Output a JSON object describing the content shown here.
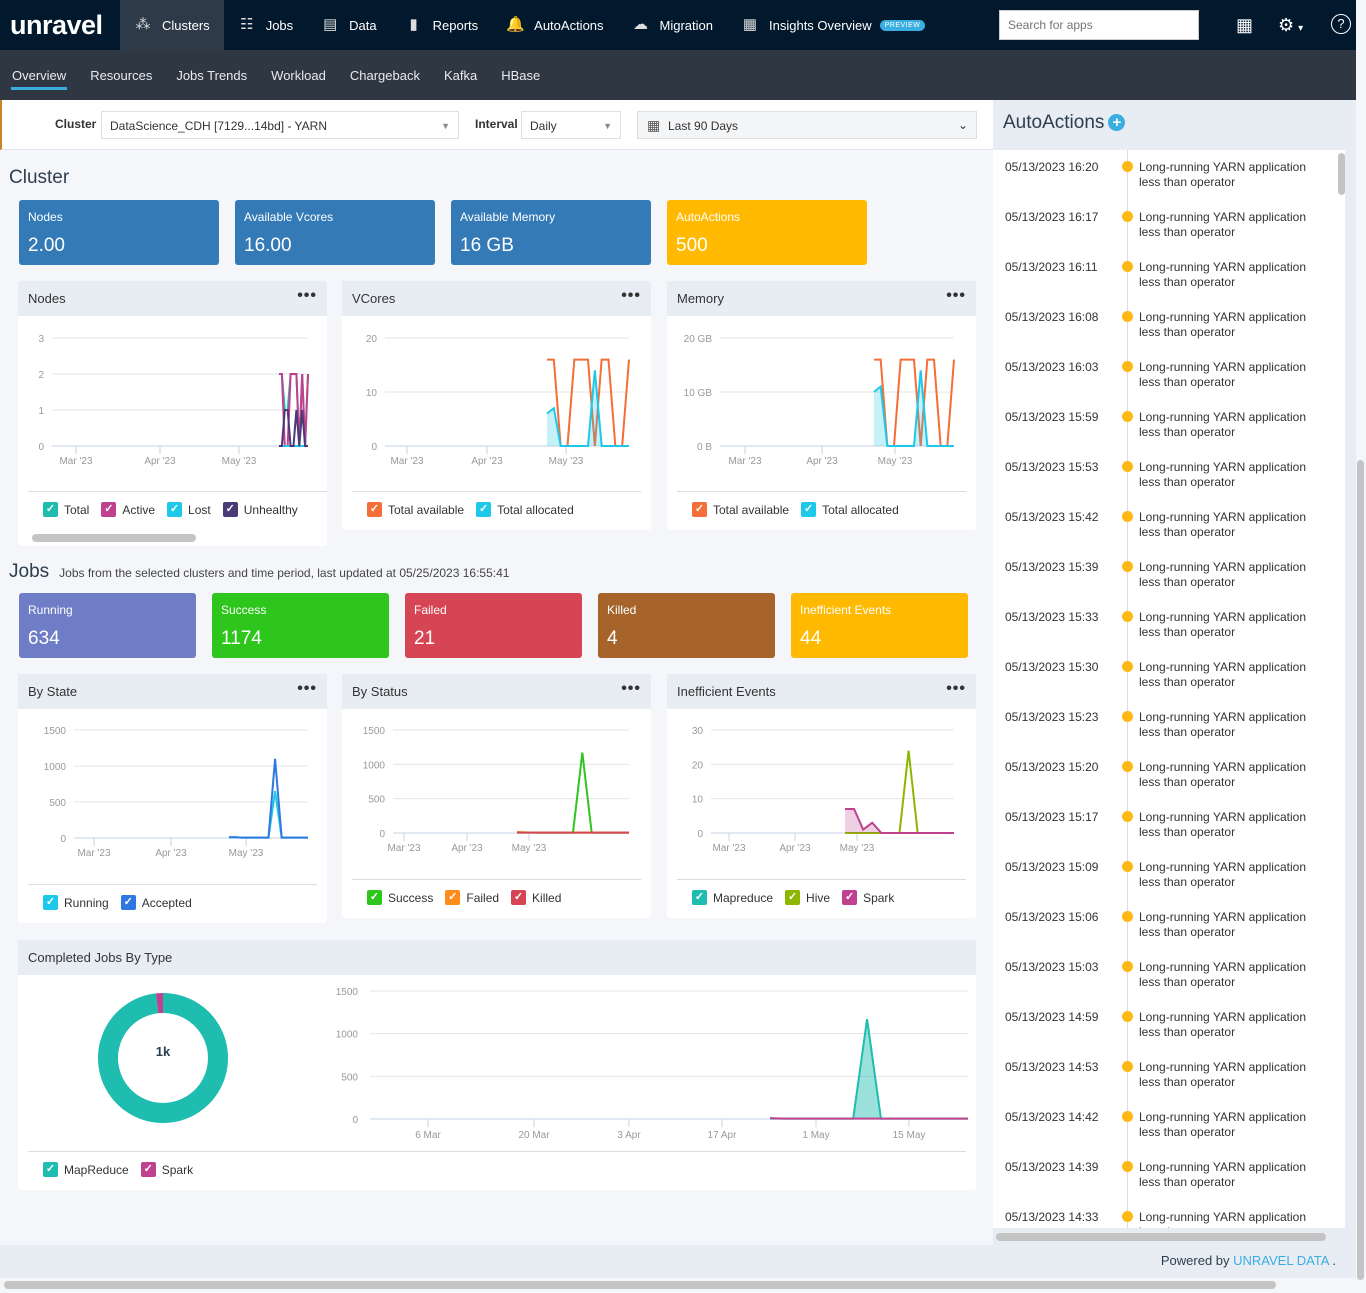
{
  "app": {
    "logo": "unravel"
  },
  "nav": [
    {
      "label": "Clusters",
      "icon": "clusters-icon",
      "glyph": "⁂",
      "active": true
    },
    {
      "label": "Jobs",
      "icon": "jobs-icon",
      "glyph": "☷",
      "active": false
    },
    {
      "label": "Data",
      "icon": "data-icon",
      "glyph": "▤",
      "active": false
    },
    {
      "label": "Reports",
      "icon": "reports-icon",
      "glyph": "▮",
      "active": false
    },
    {
      "label": "AutoActions",
      "icon": "bell-icon",
      "glyph": "🔔",
      "active": false
    },
    {
      "label": "Migration",
      "icon": "cloud-icon",
      "glyph": "☁",
      "active": false
    },
    {
      "label": "Insights Overview",
      "icon": "insights-icon",
      "glyph": "▦",
      "active": false,
      "badge": "PREVIEW"
    }
  ],
  "search": {
    "placeholder": "Search for apps",
    "value": ""
  },
  "subnav": [
    "Overview",
    "Resources",
    "Jobs Trends",
    "Workload",
    "Chargeback",
    "Kafka",
    "HBase"
  ],
  "subnav_active": "Overview",
  "filters": {
    "cluster_label": "Cluster",
    "cluster_value": "DataScience_CDH [7129...14bd] - YARN",
    "interval_label": "Interval",
    "interval_value": "Daily",
    "range_value": "Last 90 Days"
  },
  "cluster_section": {
    "title": "Cluster",
    "kpis": [
      {
        "label": "Nodes",
        "value": "2.00",
        "color": "#337ab7"
      },
      {
        "label": "Available Vcores",
        "value": "16.00",
        "color": "#337ab7"
      },
      {
        "label": "Available Memory",
        "value": "16 GB",
        "color": "#337ab7"
      },
      {
        "label": "AutoActions",
        "value": "500",
        "color": "#ffb900"
      }
    ]
  },
  "jobs_section": {
    "title": "Jobs",
    "subtitle": "Jobs from the selected clusters and time period, last updated at 05/25/2023 16:55:41",
    "kpis": [
      {
        "label": "Running",
        "value": "634",
        "color": "#6f7cc6"
      },
      {
        "label": "Success",
        "value": "1174",
        "color": "#2ec51d"
      },
      {
        "label": "Failed",
        "value": "21",
        "color": "#d64553"
      },
      {
        "label": "Killed",
        "value": "4",
        "color": "#a6642b"
      },
      {
        "label": "Inefficient Events",
        "value": "44",
        "color": "#ffb900"
      }
    ]
  },
  "chart_data": [
    {
      "id": "nodes",
      "title": "Nodes",
      "type": "line",
      "x_ticks": [
        "Mar '23",
        "Apr '23",
        "May '23"
      ],
      "y_ticks": [
        "0",
        "1",
        "2",
        "3"
      ],
      "ylim": [
        0,
        3
      ],
      "x": [
        0,
        1,
        2,
        3,
        4,
        5,
        6,
        7,
        8,
        9,
        10,
        11,
        12,
        13,
        14,
        15,
        16,
        17,
        18,
        19,
        20,
        21,
        22,
        23,
        24,
        25,
        26,
        27,
        28,
        29,
        30,
        31
      ],
      "series": [
        {
          "name": "Total",
          "color": "#1fbcb0",
          "values": [
            null,
            null,
            null,
            null,
            null,
            null,
            null,
            null,
            null,
            null,
            null,
            null,
            null,
            null,
            null,
            null,
            null,
            null,
            null,
            null,
            null,
            2,
            2,
            1,
            1,
            2,
            2,
            2,
            0,
            2,
            0,
            2
          ]
        },
        {
          "name": "Active",
          "color": "#c0418d",
          "values": [
            null,
            null,
            null,
            null,
            null,
            null,
            null,
            null,
            null,
            null,
            null,
            null,
            null,
            null,
            null,
            null,
            null,
            null,
            null,
            null,
            null,
            2,
            2,
            0,
            0,
            2,
            2,
            2,
            0,
            2,
            0,
            2
          ]
        },
        {
          "name": "Lost",
          "color": "#1ec8e8",
          "values": [
            null,
            null,
            null,
            null,
            null,
            null,
            null,
            null,
            null,
            null,
            null,
            null,
            null,
            null,
            null,
            null,
            null,
            null,
            null,
            null,
            null,
            0,
            0,
            0,
            0,
            0,
            0,
            0,
            0,
            0,
            0,
            0
          ]
        },
        {
          "name": "Unhealthy",
          "color": "#4b3a78",
          "values": [
            null,
            null,
            null,
            null,
            null,
            null,
            null,
            null,
            null,
            null,
            null,
            null,
            null,
            null,
            null,
            null,
            null,
            null,
            null,
            null,
            null,
            0,
            0,
            1,
            1,
            0,
            0,
            1,
            0,
            1,
            0,
            0
          ]
        }
      ],
      "legend": [
        "Total",
        "Active",
        "Lost",
        "Unhealthy"
      ]
    },
    {
      "id": "vcores",
      "title": "VCores",
      "type": "line",
      "x_ticks": [
        "Mar '23",
        "Apr '23",
        "May '23"
      ],
      "y_ticks": [
        "0",
        "10",
        "20"
      ],
      "ylim": [
        0,
        20
      ],
      "series": [
        {
          "name": "Total available",
          "color": "#f56d37",
          "values": [
            16,
            16,
            0,
            0,
            16,
            16,
            16,
            0,
            16,
            16,
            0,
            0,
            16
          ]
        },
        {
          "name": "Total allocated",
          "color": "#1ec8e8",
          "values": [
            6,
            7,
            0,
            0,
            0,
            0,
            0,
            14,
            0,
            0,
            0,
            0,
            0
          ]
        }
      ],
      "legend": [
        "Total available",
        "Total allocated"
      ]
    },
    {
      "id": "memory",
      "title": "Memory",
      "type": "line",
      "x_ticks": [
        "Mar '23",
        "Apr '23",
        "May '23"
      ],
      "y_ticks": [
        "0 B",
        "10 GB",
        "20 GB"
      ],
      "ylim": [
        0,
        20
      ],
      "series": [
        {
          "name": "Total available",
          "color": "#f56d37",
          "values": [
            16,
            16,
            0,
            0,
            16,
            16,
            16,
            0,
            16,
            16,
            0,
            0,
            16
          ]
        },
        {
          "name": "Total allocated",
          "color": "#1ec8e8",
          "values": [
            10,
            11,
            0,
            0,
            0,
            0,
            0,
            14,
            0,
            0,
            0,
            0,
            0
          ]
        }
      ],
      "legend": [
        "Total available",
        "Total allocated"
      ]
    },
    {
      "id": "by_state",
      "title": "By State",
      "type": "line",
      "x_ticks": [
        "Mar '23",
        "Apr '23",
        "May '23"
      ],
      "y_ticks": [
        "0",
        "500",
        "1000",
        "1500"
      ],
      "ylim": [
        0,
        1500
      ],
      "series": [
        {
          "name": "Running",
          "color": "#1ec8e8",
          "values": [
            10,
            10,
            5,
            5,
            5,
            5,
            5,
            650,
            5,
            5,
            5,
            5,
            5
          ]
        },
        {
          "name": "Accepted",
          "color": "#2f78e0",
          "values": [
            10,
            10,
            5,
            5,
            5,
            5,
            5,
            1100,
            5,
            5,
            5,
            5,
            5
          ]
        }
      ],
      "legend": [
        "Running",
        "Accepted"
      ]
    },
    {
      "id": "by_status",
      "title": "By Status",
      "type": "line",
      "x_ticks": [
        "Mar '23",
        "Apr '23",
        "May '23"
      ],
      "y_ticks": [
        "0",
        "500",
        "1000",
        "1500"
      ],
      "ylim": [
        0,
        1500
      ],
      "series": [
        {
          "name": "Success",
          "color": "#2ec51d",
          "values": [
            5,
            5,
            5,
            5,
            5,
            5,
            5,
            1170,
            5,
            5,
            5,
            5,
            5
          ]
        },
        {
          "name": "Failed",
          "color": "#ff8c1a",
          "values": [
            15,
            10,
            5,
            5,
            5,
            5,
            5,
            5,
            5,
            5,
            5,
            5,
            5
          ]
        },
        {
          "name": "Killed",
          "color": "#d64553",
          "values": [
            5,
            5,
            5,
            5,
            5,
            5,
            5,
            5,
            5,
            5,
            5,
            5,
            5
          ]
        }
      ],
      "legend": [
        "Success",
        "Failed",
        "Killed"
      ]
    },
    {
      "id": "inefficient_events",
      "title": "Inefficient Events",
      "type": "line",
      "x_ticks": [
        "Mar '23",
        "Apr '23",
        "May '23"
      ],
      "y_ticks": [
        "0",
        "10",
        "20",
        "30"
      ],
      "ylim": [
        0,
        30
      ],
      "series": [
        {
          "name": "Mapreduce",
          "color": "#1fbcb0",
          "values": [
            0,
            0,
            0,
            0,
            0,
            0,
            0,
            0,
            0,
            0,
            0,
            0,
            0
          ]
        },
        {
          "name": "Hive",
          "color": "#8db600",
          "values": [
            0,
            0,
            0,
            0,
            0,
            0,
            0,
            24,
            0,
            0,
            0,
            0,
            0
          ]
        },
        {
          "name": "Spark",
          "color": "#c0418d",
          "values": [
            7,
            7,
            1,
            3,
            0,
            0,
            0,
            0,
            0,
            0,
            0,
            0,
            0
          ]
        }
      ],
      "legend": [
        "Mapreduce",
        "Hive",
        "Spark"
      ]
    },
    {
      "id": "completed_jobs_by_type",
      "title": "Completed Jobs By Type",
      "type": "pie",
      "center_label": "1k",
      "slices": [
        {
          "name": "MapReduce",
          "value": 1150,
          "color": "#1fbcb0"
        },
        {
          "name": "Spark",
          "value": 20,
          "color": "#c0418d"
        }
      ],
      "legend": [
        "MapReduce",
        "Spark"
      ]
    },
    {
      "id": "completed_jobs_timeline",
      "title": "",
      "type": "area",
      "x_ticks": [
        "6 Mar",
        "20 Mar",
        "3 Apr",
        "17 Apr",
        "1 May",
        "15 May"
      ],
      "y_ticks": [
        "0",
        "500",
        "1000",
        "1500"
      ],
      "ylim": [
        0,
        1500
      ],
      "series": [
        {
          "name": "MapReduce",
          "color": "#1fbcb0",
          "values": [
            5,
            5,
            5,
            5,
            5,
            5,
            5,
            1170,
            5,
            5,
            5,
            5,
            5,
            5,
            5,
            5
          ]
        },
        {
          "name": "Spark",
          "color": "#c0418d",
          "values": [
            10,
            5,
            5,
            5,
            5,
            5,
            5,
            5,
            5,
            5,
            5,
            5,
            5,
            5,
            5,
            5
          ]
        }
      ]
    }
  ],
  "autoactions": {
    "title": "AutoActions",
    "items": [
      {
        "time": "05/13/2023 16:20",
        "msg": "Long-running YARN application less than operator"
      },
      {
        "time": "05/13/2023 16:17",
        "msg": "Long-running YARN application less than operator"
      },
      {
        "time": "05/13/2023 16:11",
        "msg": "Long-running YARN application less than operator"
      },
      {
        "time": "05/13/2023 16:08",
        "msg": "Long-running YARN application less than operator"
      },
      {
        "time": "05/13/2023 16:03",
        "msg": "Long-running YARN application less than operator"
      },
      {
        "time": "05/13/2023 15:59",
        "msg": "Long-running YARN application less than operator"
      },
      {
        "time": "05/13/2023 15:53",
        "msg": "Long-running YARN application less than operator"
      },
      {
        "time": "05/13/2023 15:42",
        "msg": "Long-running YARN application less than operator"
      },
      {
        "time": "05/13/2023 15:39",
        "msg": "Long-running YARN application less than operator"
      },
      {
        "time": "05/13/2023 15:33",
        "msg": "Long-running YARN application less than operator"
      },
      {
        "time": "05/13/2023 15:30",
        "msg": "Long-running YARN application less than operator"
      },
      {
        "time": "05/13/2023 15:23",
        "msg": "Long-running YARN application less than operator"
      },
      {
        "time": "05/13/2023 15:20",
        "msg": "Long-running YARN application less than operator"
      },
      {
        "time": "05/13/2023 15:17",
        "msg": "Long-running YARN application less than operator"
      },
      {
        "time": "05/13/2023 15:09",
        "msg": "Long-running YARN application less than operator"
      },
      {
        "time": "05/13/2023 15:06",
        "msg": "Long-running YARN application less than operator"
      },
      {
        "time": "05/13/2023 15:03",
        "msg": "Long-running YARN application less than operator"
      },
      {
        "time": "05/13/2023 14:59",
        "msg": "Long-running YARN application less than operator"
      },
      {
        "time": "05/13/2023 14:53",
        "msg": "Long-running YARN application less than operator"
      },
      {
        "time": "05/13/2023 14:42",
        "msg": "Long-running YARN application less than operator"
      },
      {
        "time": "05/13/2023 14:39",
        "msg": "Long-running YARN application less than operator"
      },
      {
        "time": "05/13/2023 14:33",
        "msg": "Long-running YARN application less than operator"
      }
    ]
  },
  "footer": {
    "prefix": "Powered by",
    "brand": "UNRAVEL DATA",
    "suffix": "."
  }
}
